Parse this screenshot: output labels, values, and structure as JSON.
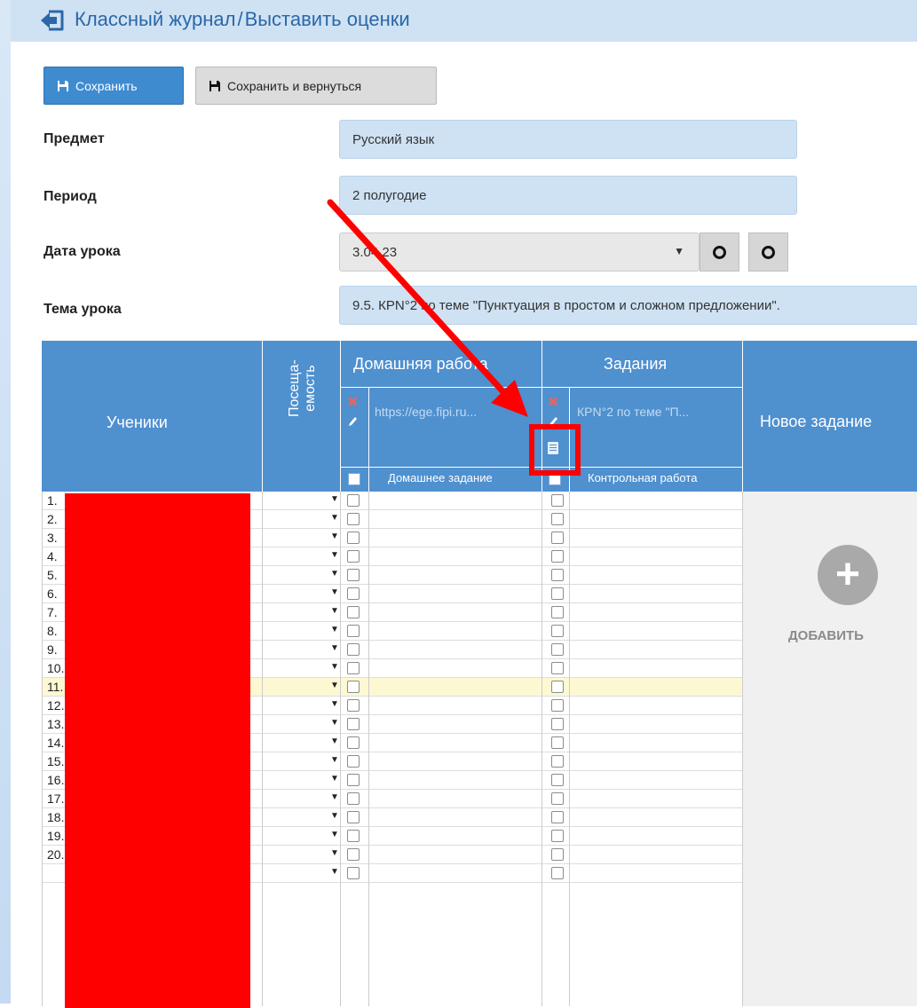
{
  "header": {
    "breadcrumb_parent": "Классный журнал",
    "separator": "/",
    "breadcrumb_current": "Выставить оценки",
    "back_icon": "back-arrow-icon"
  },
  "toolbar": {
    "save_label": "Сохранить",
    "save_return_label": "Сохранить и вернуться",
    "save_icon": "floppy-disk-icon"
  },
  "form": {
    "subject_label": "Предмет",
    "subject_value": "Русский язык",
    "period_label": "Период",
    "period_value": "2 полугодие",
    "date_label": "Дата урока",
    "date_value": "3.04.23",
    "topic_label": "Тема урока",
    "topic_value": "9.5. КРN°2 по теме \"Пунктуация в простом и сложном предложении\"."
  },
  "table": {
    "col_students": "Ученики",
    "col_attendance_line1": "Посеща-",
    "col_attendance_line2": "емость",
    "group_homework": "Домашняя работа",
    "group_tasks": "Задания",
    "homework_link": "https://ege.fipi.ru...",
    "homework_type": "Домашнее задание",
    "task_title": "КРN°2 по теме \"П...",
    "task_type": "Контрольная работа",
    "new_task": "Новое задание",
    "add_label": "ДОБАВИТЬ",
    "rows": [
      "1.",
      "2.",
      "3.",
      "4.",
      "5.",
      "6.",
      "7.",
      "8.",
      "9.",
      "10.",
      "11.",
      "12.",
      "13.",
      "14.",
      "15.",
      "16.",
      "17.",
      "18.",
      "19.",
      "20.",
      ""
    ],
    "highlighted_row": 11
  },
  "colors": {
    "header_bg": "#cfe2f3",
    "accent": "#4f90cf",
    "title_text": "#2b67a8",
    "annotation": "#ff0000"
  }
}
